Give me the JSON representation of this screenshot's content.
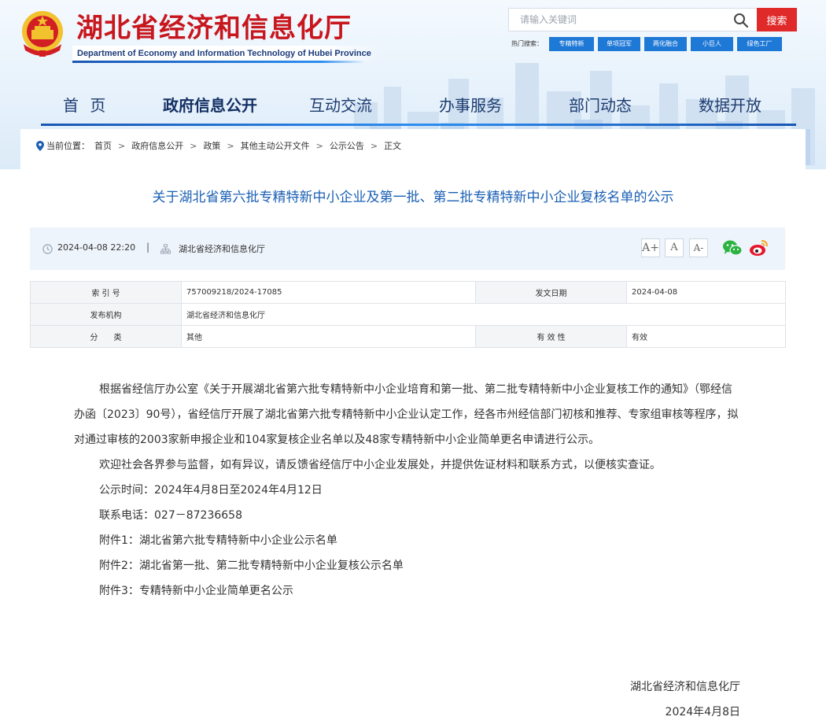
{
  "site": {
    "title": "湖北省经济和信息化厅",
    "subtitle": "Department of Economy and Information Technology of Hubei Province",
    "colors": {
      "brand_red": "#c8161d",
      "nav_blue": "#1d3c70",
      "accent_blue": "#1e78d6",
      "title_blue": "#1a5fb4"
    }
  },
  "search": {
    "placeholder": "请输入关键词",
    "button_label": "搜索",
    "icon": "search-icon"
  },
  "hot_search": {
    "label": "热门搜索：",
    "tags": [
      "专精特新",
      "单项冠军",
      "两化融合",
      "小巨人",
      "绿色工厂"
    ]
  },
  "nav": {
    "items": [
      {
        "label": "首  页"
      },
      {
        "label": "政府信息公开",
        "active": true
      },
      {
        "label": "互动交流"
      },
      {
        "label": "办事服务"
      },
      {
        "label": "部门动态"
      },
      {
        "label": "数据开放"
      }
    ]
  },
  "breadcrumb": {
    "prefix": "当前位置：",
    "items": [
      "首页",
      "政府信息公开",
      "政策",
      "其他主动公开文件",
      "公示公告",
      "正文"
    ],
    "separator": ">"
  },
  "article": {
    "title": "关于湖北省第六批专精特新中小企业及第一批、第二批专精特新中小企业复核名单的公示",
    "datetime": "2024-04-08 22:20",
    "source": "湖北省经济和信息化厅",
    "font_sizes": [
      "A+",
      "A",
      "A-"
    ],
    "share": [
      "wechat-icon",
      "weibo-icon"
    ]
  },
  "info": {
    "index_label": "索 引 号",
    "index_value": "757009218/2024-17085",
    "date_label": "发文日期",
    "date_value": "2024-04-08",
    "org_label": "发布机构",
    "org_value": "湖北省经济和信息化厅",
    "category_label": "分　　类",
    "category_value": "其他",
    "validity_label": "有 效 性",
    "validity_value": "有效"
  },
  "body": {
    "p1": "根据省经信厅办公室《关于开展湖北省第六批专精特新中小企业培育和第一批、第二批专精特新中小企业复核工作的通知》（鄂经信办函〔2023〕90号），省经信厅开展了湖北省第六批专精特新中小企业认定工作，经各市州经信部门初核和推荐、专家组审核等程序，拟对通过审核的2003家新申报企业和104家复核企业名单以及48家专精特新中小企业简单更名申请进行公示。",
    "p2": "欢迎社会各界参与监督，如有异议，请反馈省经信厅中小企业发展处，并提供佐证材料和联系方式，以便核实查证。",
    "period": "公示时间：2024年4月8日至2024年4月12日",
    "phone": "联系电话：027－87236658",
    "att1": "附件1：湖北省第六批专精特新中小企业公示名单",
    "att2": "附件2：湖北省第一批、第二批专精特新中小企业复核公示名单",
    "att3": "附件3：专精特新中小企业简单更名公示",
    "signature": "湖北省经济和信息化厅",
    "sign_date": "2024年4月8日"
  }
}
